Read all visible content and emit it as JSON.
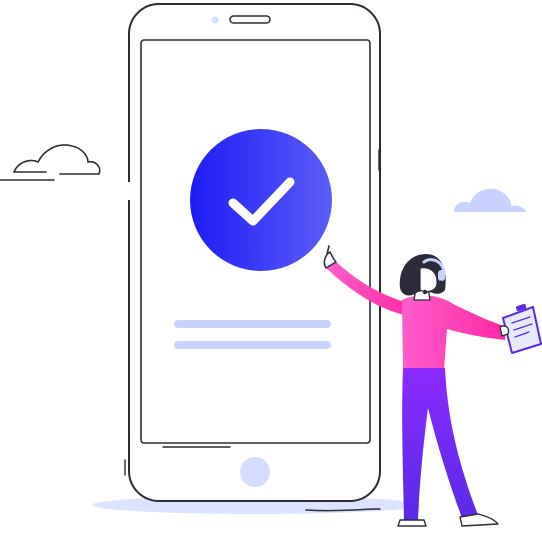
{
  "illustration": {
    "subject": "phone-confirmation-success",
    "icons": {
      "status": "checkmark-icon",
      "document": "clipboard-icon",
      "headset": "headset-icon",
      "clouds": "cloud-icon"
    },
    "colors": {
      "accent_start": "#1d1cf5",
      "accent_end": "#5b5ef7",
      "pink": "#ff3fae",
      "purple": "#7a2cff",
      "soft_lavender": "#c9d2ff",
      "line": "#2b2b3a"
    }
  }
}
